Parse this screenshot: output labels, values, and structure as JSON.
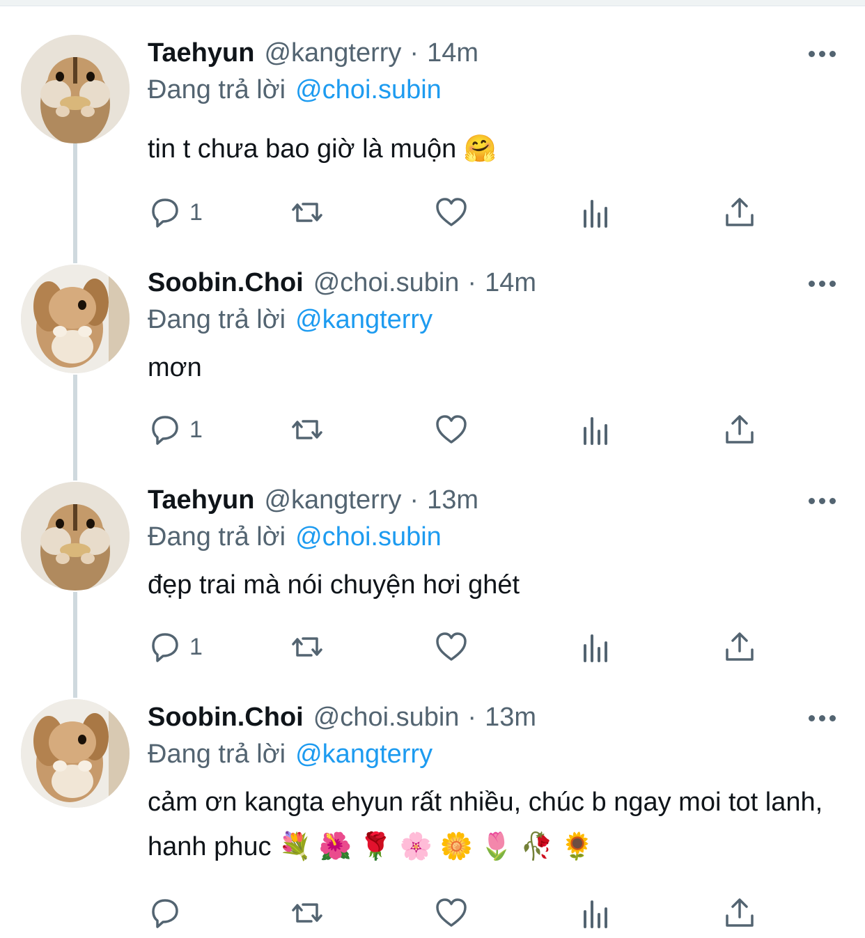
{
  "tweets": [
    {
      "name": "Taehyun",
      "handle": "@kangterry",
      "separator": "·",
      "time": "14m",
      "reply_prefix": "Đang trả lời",
      "reply_to": "@choi.subin",
      "text": "tin t chưa bao giờ là muộn 🤗",
      "reply_count": "1",
      "avatar_icon": "chipmunk-avatar"
    },
    {
      "name": "Soobin.Choi",
      "handle": "@choi.subin",
      "separator": "·",
      "time": "14m",
      "reply_prefix": "Đang trả lời",
      "reply_to": "@kangterry",
      "text": "mơn",
      "reply_count": "1",
      "avatar_icon": "bunny-avatar"
    },
    {
      "name": "Taehyun",
      "handle": "@kangterry",
      "separator": "·",
      "time": "13m",
      "reply_prefix": "Đang trả lời",
      "reply_to": "@choi.subin",
      "text": "đẹp trai mà nói chuyện hơi ghét",
      "reply_count": "1",
      "avatar_icon": "chipmunk-avatar"
    },
    {
      "name": "Soobin.Choi",
      "handle": "@choi.subin",
      "separator": "·",
      "time": "13m",
      "reply_prefix": "Đang trả lời",
      "reply_to": "@kangterry",
      "text": "cảm ơn kangta ehyun rất nhiều, chúc b ngay moi tot lanh, hanh phuc 💐 🌺 🌹 🌸 🌼 🌷 🥀 🌻",
      "reply_count": "",
      "avatar_icon": "bunny-avatar"
    }
  ],
  "icons": {
    "reply": "reply-icon",
    "retweet": "retweet-icon",
    "like": "heart-icon",
    "views": "analytics-icon",
    "share": "share-icon",
    "more": "more-icon"
  },
  "colors": {
    "accent": "#1d9bf0",
    "secondary_text": "#536471",
    "thread_line": "#cfd9de"
  }
}
